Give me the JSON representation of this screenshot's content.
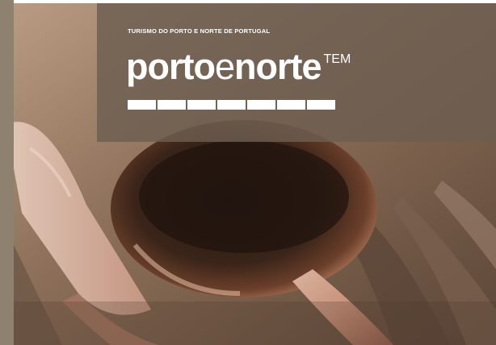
{
  "header": {
    "tagline": "TURISMO DO PORTO E NORTE DE PORTUGAL"
  },
  "logo": {
    "part_porto": "porto",
    "part_e": "e",
    "part_norte": "norte",
    "suffix": "TEM"
  },
  "colors": {
    "side_strip": "#8f8170",
    "overlay": "#6c5e50",
    "text": "#ffffff"
  },
  "segment_count": 7
}
